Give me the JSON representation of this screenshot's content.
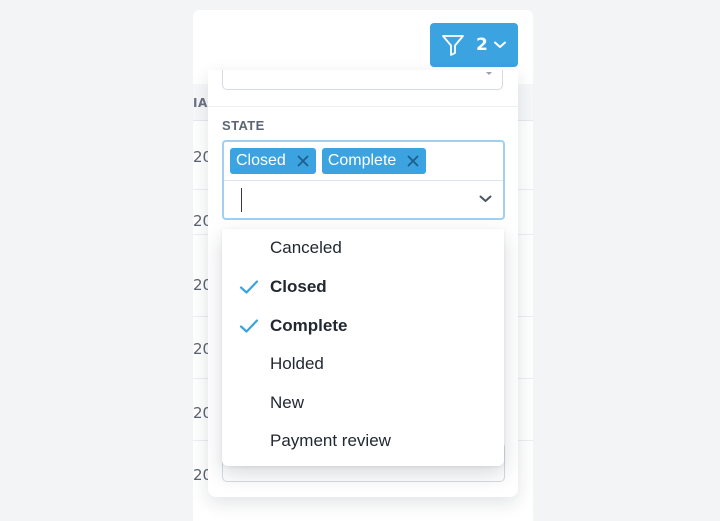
{
  "background": {
    "column_header_fragment": "IAI",
    "row_cell_fragment": "20"
  },
  "filter_button": {
    "count": "2",
    "icon": "funnel-icon"
  },
  "state_filter": {
    "label": "STATE",
    "selected_chips": [
      {
        "label": "Closed"
      },
      {
        "label": "Complete"
      }
    ],
    "input_value": "",
    "options": [
      {
        "label": "Canceled",
        "selected": false
      },
      {
        "label": "Closed",
        "selected": true
      },
      {
        "label": "Complete",
        "selected": true
      },
      {
        "label": "Holded",
        "selected": false
      },
      {
        "label": "New",
        "selected": false
      },
      {
        "label": "Payment review",
        "selected": false
      }
    ]
  },
  "colors": {
    "accent": "#3ba3e0",
    "focus_border": "#9fd0f2",
    "check": "#3ba3e0"
  }
}
